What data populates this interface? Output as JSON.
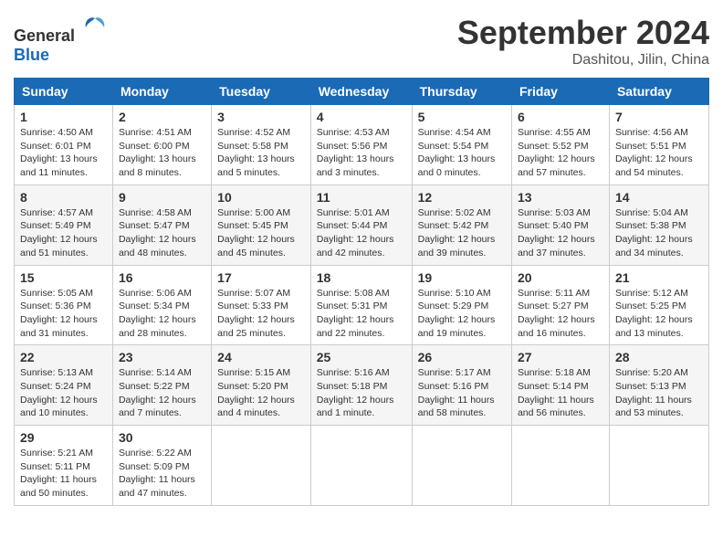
{
  "header": {
    "logo_general": "General",
    "logo_blue": "Blue",
    "month_title": "September 2024",
    "location": "Dashitou, Jilin, China"
  },
  "weekdays": [
    "Sunday",
    "Monday",
    "Tuesday",
    "Wednesday",
    "Thursday",
    "Friday",
    "Saturday"
  ],
  "weeks": [
    [
      {
        "day": "1",
        "sunrise": "4:50 AM",
        "sunset": "6:01 PM",
        "daylight": "13 hours and 11 minutes."
      },
      {
        "day": "2",
        "sunrise": "4:51 AM",
        "sunset": "6:00 PM",
        "daylight": "13 hours and 8 minutes."
      },
      {
        "day": "3",
        "sunrise": "4:52 AM",
        "sunset": "5:58 PM",
        "daylight": "13 hours and 5 minutes."
      },
      {
        "day": "4",
        "sunrise": "4:53 AM",
        "sunset": "5:56 PM",
        "daylight": "13 hours and 3 minutes."
      },
      {
        "day": "5",
        "sunrise": "4:54 AM",
        "sunset": "5:54 PM",
        "daylight": "13 hours and 0 minutes."
      },
      {
        "day": "6",
        "sunrise": "4:55 AM",
        "sunset": "5:52 PM",
        "daylight": "12 hours and 57 minutes."
      },
      {
        "day": "7",
        "sunrise": "4:56 AM",
        "sunset": "5:51 PM",
        "daylight": "12 hours and 54 minutes."
      }
    ],
    [
      {
        "day": "8",
        "sunrise": "4:57 AM",
        "sunset": "5:49 PM",
        "daylight": "12 hours and 51 minutes."
      },
      {
        "day": "9",
        "sunrise": "4:58 AM",
        "sunset": "5:47 PM",
        "daylight": "12 hours and 48 minutes."
      },
      {
        "day": "10",
        "sunrise": "5:00 AM",
        "sunset": "5:45 PM",
        "daylight": "12 hours and 45 minutes."
      },
      {
        "day": "11",
        "sunrise": "5:01 AM",
        "sunset": "5:44 PM",
        "daylight": "12 hours and 42 minutes."
      },
      {
        "day": "12",
        "sunrise": "5:02 AM",
        "sunset": "5:42 PM",
        "daylight": "12 hours and 39 minutes."
      },
      {
        "day": "13",
        "sunrise": "5:03 AM",
        "sunset": "5:40 PM",
        "daylight": "12 hours and 37 minutes."
      },
      {
        "day": "14",
        "sunrise": "5:04 AM",
        "sunset": "5:38 PM",
        "daylight": "12 hours and 34 minutes."
      }
    ],
    [
      {
        "day": "15",
        "sunrise": "5:05 AM",
        "sunset": "5:36 PM",
        "daylight": "12 hours and 31 minutes."
      },
      {
        "day": "16",
        "sunrise": "5:06 AM",
        "sunset": "5:34 PM",
        "daylight": "12 hours and 28 minutes."
      },
      {
        "day": "17",
        "sunrise": "5:07 AM",
        "sunset": "5:33 PM",
        "daylight": "12 hours and 25 minutes."
      },
      {
        "day": "18",
        "sunrise": "5:08 AM",
        "sunset": "5:31 PM",
        "daylight": "12 hours and 22 minutes."
      },
      {
        "day": "19",
        "sunrise": "5:10 AM",
        "sunset": "5:29 PM",
        "daylight": "12 hours and 19 minutes."
      },
      {
        "day": "20",
        "sunrise": "5:11 AM",
        "sunset": "5:27 PM",
        "daylight": "12 hours and 16 minutes."
      },
      {
        "day": "21",
        "sunrise": "5:12 AM",
        "sunset": "5:25 PM",
        "daylight": "12 hours and 13 minutes."
      }
    ],
    [
      {
        "day": "22",
        "sunrise": "5:13 AM",
        "sunset": "5:24 PM",
        "daylight": "12 hours and 10 minutes."
      },
      {
        "day": "23",
        "sunrise": "5:14 AM",
        "sunset": "5:22 PM",
        "daylight": "12 hours and 7 minutes."
      },
      {
        "day": "24",
        "sunrise": "5:15 AM",
        "sunset": "5:20 PM",
        "daylight": "12 hours and 4 minutes."
      },
      {
        "day": "25",
        "sunrise": "5:16 AM",
        "sunset": "5:18 PM",
        "daylight": "12 hours and 1 minute."
      },
      {
        "day": "26",
        "sunrise": "5:17 AM",
        "sunset": "5:16 PM",
        "daylight": "11 hours and 58 minutes."
      },
      {
        "day": "27",
        "sunrise": "5:18 AM",
        "sunset": "5:14 PM",
        "daylight": "11 hours and 56 minutes."
      },
      {
        "day": "28",
        "sunrise": "5:20 AM",
        "sunset": "5:13 PM",
        "daylight": "11 hours and 53 minutes."
      }
    ],
    [
      {
        "day": "29",
        "sunrise": "5:21 AM",
        "sunset": "5:11 PM",
        "daylight": "11 hours and 50 minutes."
      },
      {
        "day": "30",
        "sunrise": "5:22 AM",
        "sunset": "5:09 PM",
        "daylight": "11 hours and 47 minutes."
      },
      null,
      null,
      null,
      null,
      null
    ]
  ]
}
